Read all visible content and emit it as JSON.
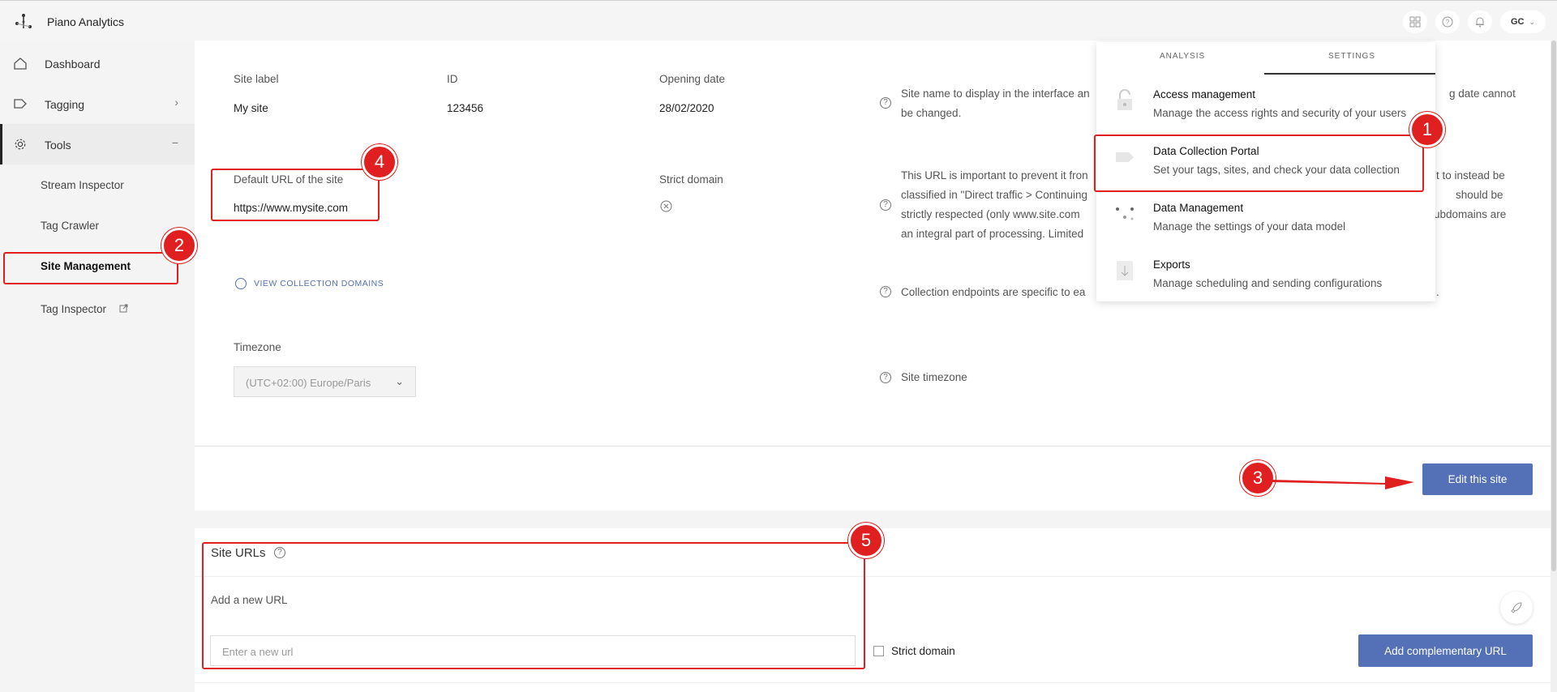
{
  "app": {
    "title": "Piano Analytics"
  },
  "header": {
    "avatar_initials": "GC"
  },
  "sidebar": {
    "items": [
      {
        "label": "Dashboard"
      },
      {
        "label": "Tagging"
      },
      {
        "label": "Tools"
      }
    ],
    "tools_collapse": "−",
    "tagging_chevron": "›",
    "sub_items": [
      {
        "label": "Stream Inspector"
      },
      {
        "label": "Tag Crawler"
      },
      {
        "label": "Site Management"
      },
      {
        "label": "Tag Inspector"
      }
    ]
  },
  "site": {
    "label_title": "Site label",
    "label_value": "My site",
    "id_title": "ID",
    "id_value": "123456",
    "opening_title": "Opening date",
    "opening_value": "28/02/2020",
    "label_help": "Site name to display in the interface an",
    "label_help_right": "g date cannot",
    "label_help_2": "be changed.",
    "url_title": "Default URL of the site",
    "url_value": "https://www.mysite.com",
    "strict_title": "Strict domain",
    "url_help_1": "This URL is important to prevent it fron",
    "url_help_2": "classified in \"Direct traffic > Continuing",
    "url_help_3": "strictly respected (only www.site.com",
    "url_help_4": "an integral part of processing. Limited",
    "url_help_r1": "it to instead be",
    "url_help_r2": "should be",
    "url_help_r3": "ubdomains are",
    "view_domains": "View collection domains",
    "collection_help": "Collection endpoints are specific to ea",
    "collection_help_r": ".",
    "timezone_title": "Timezone",
    "timezone_value": "(UTC+02:00) Europe/Paris",
    "timezone_help": "Site timezone",
    "edit_button": "Edit this site"
  },
  "site_urls": {
    "title": "Site URLs",
    "add_label": "Add a new URL",
    "input_placeholder": "Enter a new url",
    "strict_label": "Strict domain",
    "add_button": "Add complementary URL"
  },
  "dropdown": {
    "tabs": [
      {
        "label": "Analysis"
      },
      {
        "label": "Settings"
      }
    ],
    "items": [
      {
        "title": "Access management",
        "desc": "Manage the access rights and security of your users"
      },
      {
        "title": "Data Collection Portal",
        "desc": "Set your tags, sites, and check your data collection"
      },
      {
        "title": "Data Management",
        "desc": "Manage the settings of your data model"
      },
      {
        "title": "Exports",
        "desc": "Manage scheduling and sending configurations"
      }
    ]
  },
  "annotations": {
    "n1": "1",
    "n2": "2",
    "n3": "3",
    "n4": "4",
    "n5": "5"
  },
  "colors": {
    "accent": "#5470b6",
    "annotation": "#e02020"
  }
}
